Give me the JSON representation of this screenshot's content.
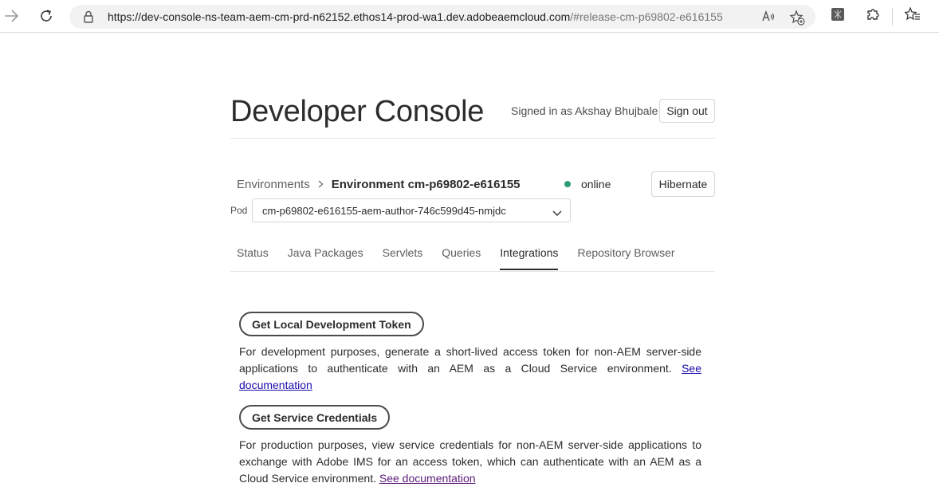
{
  "browser": {
    "url_host": "https://dev-console-ns-team-aem-cm-prd-n62152.ethos14-prod-wa1.dev.adobeaemcloud.com",
    "url_path": "/#release-cm-p69802-e616155",
    "icons": [
      "back-arrow-icon",
      "refresh-icon",
      "lock-icon",
      "read-aloud-icon",
      "add-favorite-icon",
      "extension-puzzle-icon",
      "favorites-icon"
    ]
  },
  "header": {
    "title": "Developer Console",
    "signed_in": "Signed in as Akshay Bhujbale",
    "sign_out": "Sign out"
  },
  "environment": {
    "breadcrumb_root": "Environments",
    "breadcrumb_current": "Environment cm-p69802-e616155",
    "status": "online",
    "status_color": "#2d9d78",
    "hibernate": "Hibernate",
    "pod_label": "Pod",
    "pod_value": "cm-p69802-e616155-aem-author-746c599d45-nmjdc"
  },
  "tabs": [
    {
      "label": "Status"
    },
    {
      "label": "Java Packages"
    },
    {
      "label": "Servlets"
    },
    {
      "label": "Queries"
    },
    {
      "label": "Integrations"
    },
    {
      "label": "Repository Browser"
    }
  ],
  "active_tab": "Integrations",
  "integrations": {
    "token_button": "Get Local Development Token",
    "token_desc": "For development purposes, generate a short-lived access token for non-AEM server-side applications to authenticate with an AEM as a Cloud Service environment.",
    "token_link": "See documentation",
    "creds_button": "Get Service Credentials",
    "creds_desc": "For production purposes, view service credentials for non-AEM server-side applications to exchange with Adobe IMS for an access token, which can authenticate with an AEM as a Cloud Service environment.",
    "creds_link": "See documentation"
  }
}
